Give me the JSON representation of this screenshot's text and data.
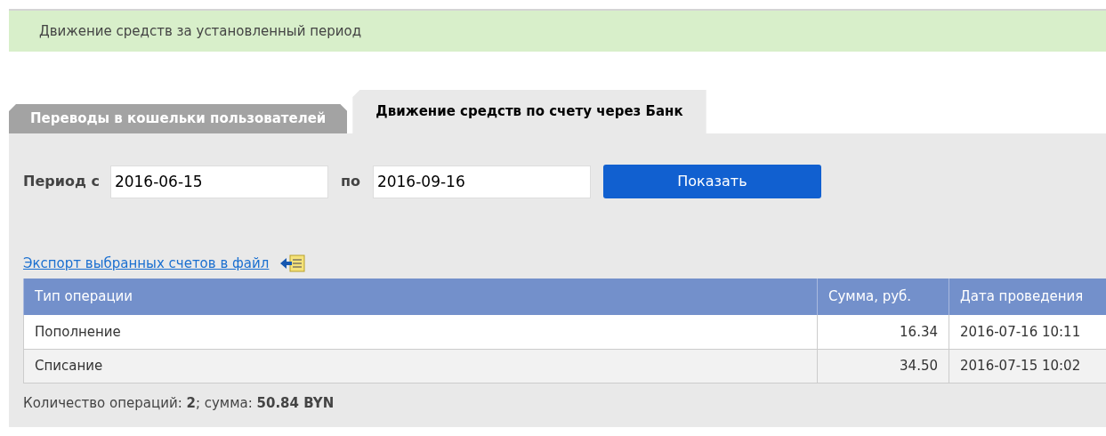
{
  "banner": {
    "title": "Движение средств за установленный период"
  },
  "tabs": [
    {
      "label": "Переводы в кошельки пользователей",
      "selected": false
    },
    {
      "label": "Движение средств по счету через Банк",
      "selected": true
    }
  ],
  "filter": {
    "from_label": "Период с",
    "from_value": "2016-06-15",
    "to_label": "по",
    "to_value": "2016-09-16",
    "button": "Показать"
  },
  "export_link": "Экспорт выбранных счетов в файл",
  "table": {
    "columns": [
      "Тип операции",
      "Сумма, руб.",
      "Дата проведения"
    ],
    "rows": [
      [
        "Пополнение",
        "16.34",
        "2016-07-16 10:11"
      ],
      [
        "Списание",
        "34.50",
        "2016-07-15 10:02"
      ]
    ]
  },
  "summary": "Количество операций: **2**; сумма: **50.84 BYN**"
}
